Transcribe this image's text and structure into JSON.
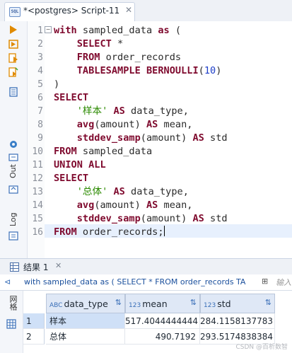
{
  "tab": {
    "title": "*<postgres> Script-11",
    "close": "✕"
  },
  "sidebar": {
    "out_label": "Out",
    "log_label": "Log"
  },
  "editor": {
    "line_numbers": [
      "1",
      "2",
      "3",
      "4",
      "5",
      "6",
      "7",
      "8",
      "9",
      "10",
      "11",
      "12",
      "13",
      "14",
      "15",
      "16"
    ],
    "lines": [
      [
        {
          "k": "kw",
          "t": "with"
        },
        {
          "k": "",
          "t": " sampled_data "
        },
        {
          "k": "kw",
          "t": "as"
        },
        {
          "k": "",
          "t": " ("
        }
      ],
      [
        {
          "k": "",
          "t": "    "
        },
        {
          "k": "kw",
          "t": "SELECT"
        },
        {
          "k": "",
          "t": " *"
        }
      ],
      [
        {
          "k": "",
          "t": "    "
        },
        {
          "k": "kw",
          "t": "FROM"
        },
        {
          "k": "",
          "t": " order_records"
        }
      ],
      [
        {
          "k": "",
          "t": "    "
        },
        {
          "k": "kw",
          "t": "TABLESAMPLE"
        },
        {
          "k": "",
          "t": " "
        },
        {
          "k": "kw",
          "t": "BERNOULLI"
        },
        {
          "k": "",
          "t": "("
        },
        {
          "k": "num",
          "t": "10"
        },
        {
          "k": "",
          "t": ")"
        }
      ],
      [
        {
          "k": "",
          "t": ")"
        }
      ],
      [
        {
          "k": "kw",
          "t": "SELECT"
        }
      ],
      [
        {
          "k": "",
          "t": "    "
        },
        {
          "k": "str",
          "t": "'样本'"
        },
        {
          "k": "",
          "t": " "
        },
        {
          "k": "kw",
          "t": "AS"
        },
        {
          "k": "",
          "t": " data_type,"
        }
      ],
      [
        {
          "k": "",
          "t": "    "
        },
        {
          "k": "kw",
          "t": "avg"
        },
        {
          "k": "",
          "t": "(amount) "
        },
        {
          "k": "kw",
          "t": "AS"
        },
        {
          "k": "",
          "t": " mean,"
        }
      ],
      [
        {
          "k": "",
          "t": "    "
        },
        {
          "k": "kw",
          "t": "stddev_samp"
        },
        {
          "k": "",
          "t": "(amount) "
        },
        {
          "k": "kw",
          "t": "AS"
        },
        {
          "k": "",
          "t": " std"
        }
      ],
      [
        {
          "k": "kw",
          "t": "FROM"
        },
        {
          "k": "",
          "t": " sampled_data"
        }
      ],
      [
        {
          "k": "kw",
          "t": "UNION ALL"
        }
      ],
      [
        {
          "k": "kw",
          "t": "SELECT"
        }
      ],
      [
        {
          "k": "",
          "t": "    "
        },
        {
          "k": "str",
          "t": "'总体'"
        },
        {
          "k": "",
          "t": " "
        },
        {
          "k": "kw",
          "t": "AS"
        },
        {
          "k": "",
          "t": " data_type,"
        }
      ],
      [
        {
          "k": "",
          "t": "    "
        },
        {
          "k": "kw",
          "t": "avg"
        },
        {
          "k": "",
          "t": "(amount) "
        },
        {
          "k": "kw",
          "t": "AS"
        },
        {
          "k": "",
          "t": " mean,"
        }
      ],
      [
        {
          "k": "",
          "t": "    "
        },
        {
          "k": "kw",
          "t": "stddev_samp"
        },
        {
          "k": "",
          "t": "(amount) "
        },
        {
          "k": "kw",
          "t": "AS"
        },
        {
          "k": "",
          "t": " std"
        }
      ],
      [
        {
          "k": "kw",
          "t": "FROM"
        },
        {
          "k": "",
          "t": " order_records;"
        }
      ]
    ]
  },
  "results": {
    "tab_label": "结果 1",
    "tab_close": "✕",
    "filter_text": "with sampled_data as ( SELECT * FROM order_records TA",
    "filter_hint": "输入",
    "side_label": "网格",
    "columns": [
      {
        "type": "ABC",
        "name": "data_type"
      },
      {
        "type": "123",
        "name": "mean"
      },
      {
        "type": "123",
        "name": "std"
      }
    ],
    "rows": [
      {
        "num": "1",
        "data_type": "样本",
        "mean": "517.4044444444",
        "std": "284.1158137783"
      },
      {
        "num": "2",
        "data_type": "总体",
        "mean": "490.7192",
        "std": "293.5174838384"
      }
    ]
  },
  "watermark": "CSDN @百析数智"
}
